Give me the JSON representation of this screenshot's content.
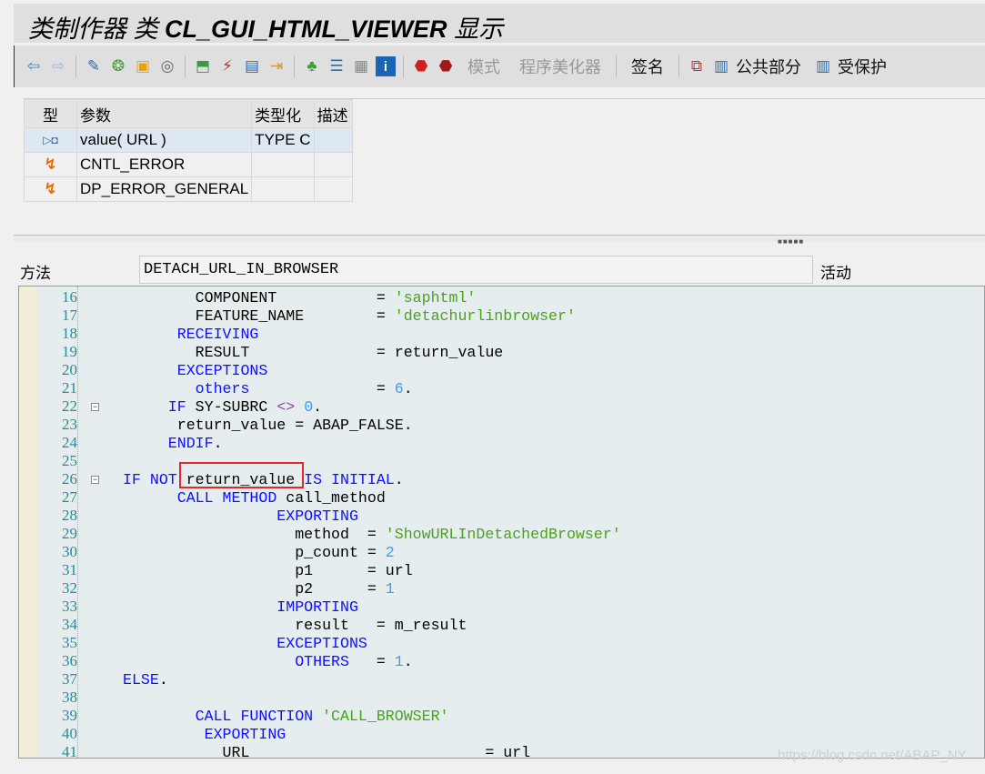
{
  "title": {
    "prefix": "类制作器 类",
    "class_name": "CL_GUI_HTML_VIEWER",
    "suffix": "显示"
  },
  "toolbar": {
    "icons": [
      "back-icon",
      "forward-icon",
      "other-object-icon",
      "check-icon",
      "activate-icon",
      "where-used-icon",
      "syntax-check-icon",
      "wizard-icon",
      "display-object-list-icon",
      "navigate-icon",
      "hierarchy-icon",
      "outline-icon",
      "table-icon",
      "info-icon",
      "stop-icon",
      "stop-remote-icon"
    ],
    "pattern": "模式",
    "pretty_printer": "程序美化器",
    "signature": "签名",
    "public_section": "公共部分",
    "protected_section": "受保护"
  },
  "params": {
    "headers": [
      "型",
      "参数",
      "类型化",
      "描述"
    ],
    "rows": [
      {
        "type_icon": "importing-parameter-icon",
        "name": "value( URL )",
        "typing": "TYPE C",
        "desc": ""
      },
      {
        "type_icon": "exception-icon",
        "name": "CNTL_ERROR",
        "typing": "",
        "desc": ""
      },
      {
        "type_icon": "exception-icon",
        "name": "DP_ERROR_GENERAL",
        "typing": "",
        "desc": ""
      }
    ]
  },
  "method": {
    "label": "方法",
    "name": "DETACH_URL_IN_BROWSER",
    "status": "活动"
  },
  "code": [
    {
      "n": "16",
      "t": [
        [
          "        COMPONENT           = ",
          ""
        ],
        [
          "'saphtml'",
          "s"
        ]
      ]
    },
    {
      "n": "17",
      "t": [
        [
          "        FEATURE_NAME        = ",
          ""
        ],
        [
          "'detachurlinbrowser'",
          "s"
        ]
      ]
    },
    {
      "n": "18",
      "t": [
        [
          "      ",
          ""
        ],
        [
          "RECEIVING",
          "k"
        ]
      ]
    },
    {
      "n": "19",
      "t": [
        [
          "        RESULT              = return_value",
          ""
        ]
      ]
    },
    {
      "n": "20",
      "t": [
        [
          "      ",
          ""
        ],
        [
          "EXCEPTIONS",
          "k"
        ]
      ]
    },
    {
      "n": "21",
      "t": [
        [
          "        ",
          ""
        ],
        [
          "others",
          "k"
        ],
        [
          "              = ",
          ""
        ],
        [
          "6",
          "n"
        ],
        [
          ".",
          ""
        ]
      ]
    },
    {
      "n": "22",
      "fold": "-",
      "t": [
        [
          "     ",
          ""
        ],
        [
          "IF",
          "k"
        ],
        [
          " SY-SUBRC ",
          ""
        ],
        [
          "<>",
          "o"
        ],
        [
          " ",
          ""
        ],
        [
          "0",
          "n"
        ],
        [
          ".",
          ""
        ]
      ]
    },
    {
      "n": "23",
      "t": [
        [
          "      return_value = ABAP_FALSE.",
          ""
        ]
      ]
    },
    {
      "n": "24",
      "t": [
        [
          "     ",
          ""
        ],
        [
          "ENDIF",
          "k"
        ],
        [
          ".",
          ""
        ]
      ]
    },
    {
      "n": "25",
      "t": []
    },
    {
      "n": "26",
      "fold": "-",
      "t": [
        [
          "",
          ""
        ],
        [
          "IF NOT",
          "k"
        ],
        [
          " return_value ",
          ""
        ],
        [
          "IS INITIAL",
          "k"
        ],
        [
          ".",
          ""
        ]
      ]
    },
    {
      "n": "27",
      "t": [
        [
          "      ",
          ""
        ],
        [
          "CALL METHOD",
          "k"
        ],
        [
          " call_method",
          ""
        ]
      ]
    },
    {
      "n": "28",
      "t": [
        [
          "                 ",
          ""
        ],
        [
          "EXPORTING",
          "k"
        ]
      ]
    },
    {
      "n": "29",
      "t": [
        [
          "                   method  = ",
          ""
        ],
        [
          "'ShowURLInDetachedBrowser'",
          "s"
        ]
      ]
    },
    {
      "n": "30",
      "t": [
        [
          "                   p_count = ",
          ""
        ],
        [
          "2",
          "n"
        ]
      ]
    },
    {
      "n": "31",
      "t": [
        [
          "                   p1      = url",
          ""
        ]
      ]
    },
    {
      "n": "32",
      "t": [
        [
          "                   p2      = ",
          ""
        ],
        [
          "1",
          "n"
        ]
      ]
    },
    {
      "n": "33",
      "t": [
        [
          "                 ",
          ""
        ],
        [
          "IMPORTING",
          "k"
        ]
      ]
    },
    {
      "n": "34",
      "t": [
        [
          "                   result   = m_result",
          ""
        ]
      ]
    },
    {
      "n": "35",
      "t": [
        [
          "                 ",
          ""
        ],
        [
          "EXCEPTIONS",
          "k"
        ]
      ]
    },
    {
      "n": "36",
      "t": [
        [
          "                   ",
          ""
        ],
        [
          "OTHERS",
          "k"
        ],
        [
          "   = ",
          ""
        ],
        [
          "1",
          "n"
        ],
        [
          ".",
          ""
        ]
      ]
    },
    {
      "n": "37",
      "t": [
        [
          "",
          ""
        ],
        [
          "ELSE",
          "k"
        ],
        [
          ".",
          ""
        ]
      ]
    },
    {
      "n": "38",
      "t": []
    },
    {
      "n": "39",
      "t": [
        [
          "        ",
          ""
        ],
        [
          "CALL FUNCTION",
          "k"
        ],
        [
          " ",
          ""
        ],
        [
          "'CALL_BROWSER'",
          "s"
        ]
      ]
    },
    {
      "n": "40",
      "t": [
        [
          "         ",
          ""
        ],
        [
          "EXPORTING",
          "k"
        ]
      ]
    },
    {
      "n": "41",
      "t": [
        [
          "           URL                          = url",
          ""
        ]
      ]
    }
  ],
  "watermark": "https://blog.csdn.net/ABAP_NY"
}
